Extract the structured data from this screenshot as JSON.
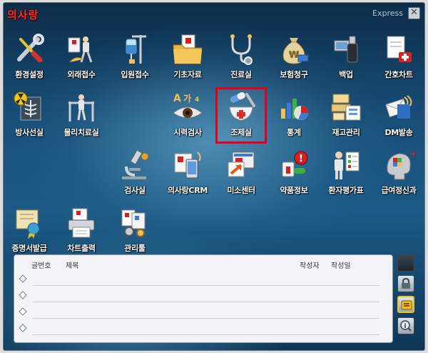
{
  "app": {
    "logo_text": "의사랑",
    "edition": "Express",
    "close_symbol": "✕"
  },
  "menu": [
    {
      "label": "환경설정",
      "icon": "wrench-screwdriver-icon"
    },
    {
      "label": "외래접수",
      "icon": "outpatient-walker-icon"
    },
    {
      "label": "입원접수",
      "icon": "iv-drip-icon"
    },
    {
      "label": "기초자료",
      "icon": "folder-documents-icon"
    },
    {
      "label": "진료실",
      "icon": "stethoscope-icon"
    },
    {
      "label": "보험청구",
      "icon": "money-bag-icon"
    },
    {
      "label": "백업",
      "icon": "usb-drive-icon"
    },
    {
      "label": "간호차트",
      "icon": "nurse-chart-icon"
    },
    {
      "label": "방사선실",
      "icon": "xray-radiation-icon"
    },
    {
      "label": "물리치료실",
      "icon": "physical-therapy-icon"
    },
    {
      "label": "시력검사",
      "icon": "eye-chart-icon"
    },
    {
      "label": "조제실",
      "icon": "mortar-capsule-icon"
    },
    {
      "label": "통계",
      "icon": "bar-pie-chart-icon"
    },
    {
      "label": "재고관리",
      "icon": "inventory-boxes-icon"
    },
    {
      "label": "DM발송",
      "icon": "dm-envelope-icon"
    },
    {
      "label": "검사실",
      "icon": "microscope-icon"
    },
    {
      "label": "의사랑CRM",
      "icon": "crm-phone-icon"
    },
    {
      "label": "미소센터",
      "icon": "monitor-arrow-icon"
    },
    {
      "label": "약품정보",
      "icon": "medicine-info-icon"
    },
    {
      "label": "환자평가표",
      "icon": "patient-evaluation-icon"
    },
    {
      "label": "급여정신과",
      "icon": "brain-puzzle-icon"
    },
    {
      "label": "증명서발급",
      "icon": "certificate-icon"
    },
    {
      "label": "차트출력",
      "icon": "printer-icon"
    },
    {
      "label": "관리툴",
      "icon": "admin-tools-icon"
    }
  ],
  "board": {
    "col_number": "글번호",
    "col_title": "제목",
    "col_author": "작성자",
    "col_date": "작성일"
  },
  "side_buttons": [
    "lock-icon",
    "notice-board-icon",
    "info-search-icon"
  ],
  "colors": {
    "highlight": "#e4001b",
    "logo": "#ff2a2a"
  }
}
